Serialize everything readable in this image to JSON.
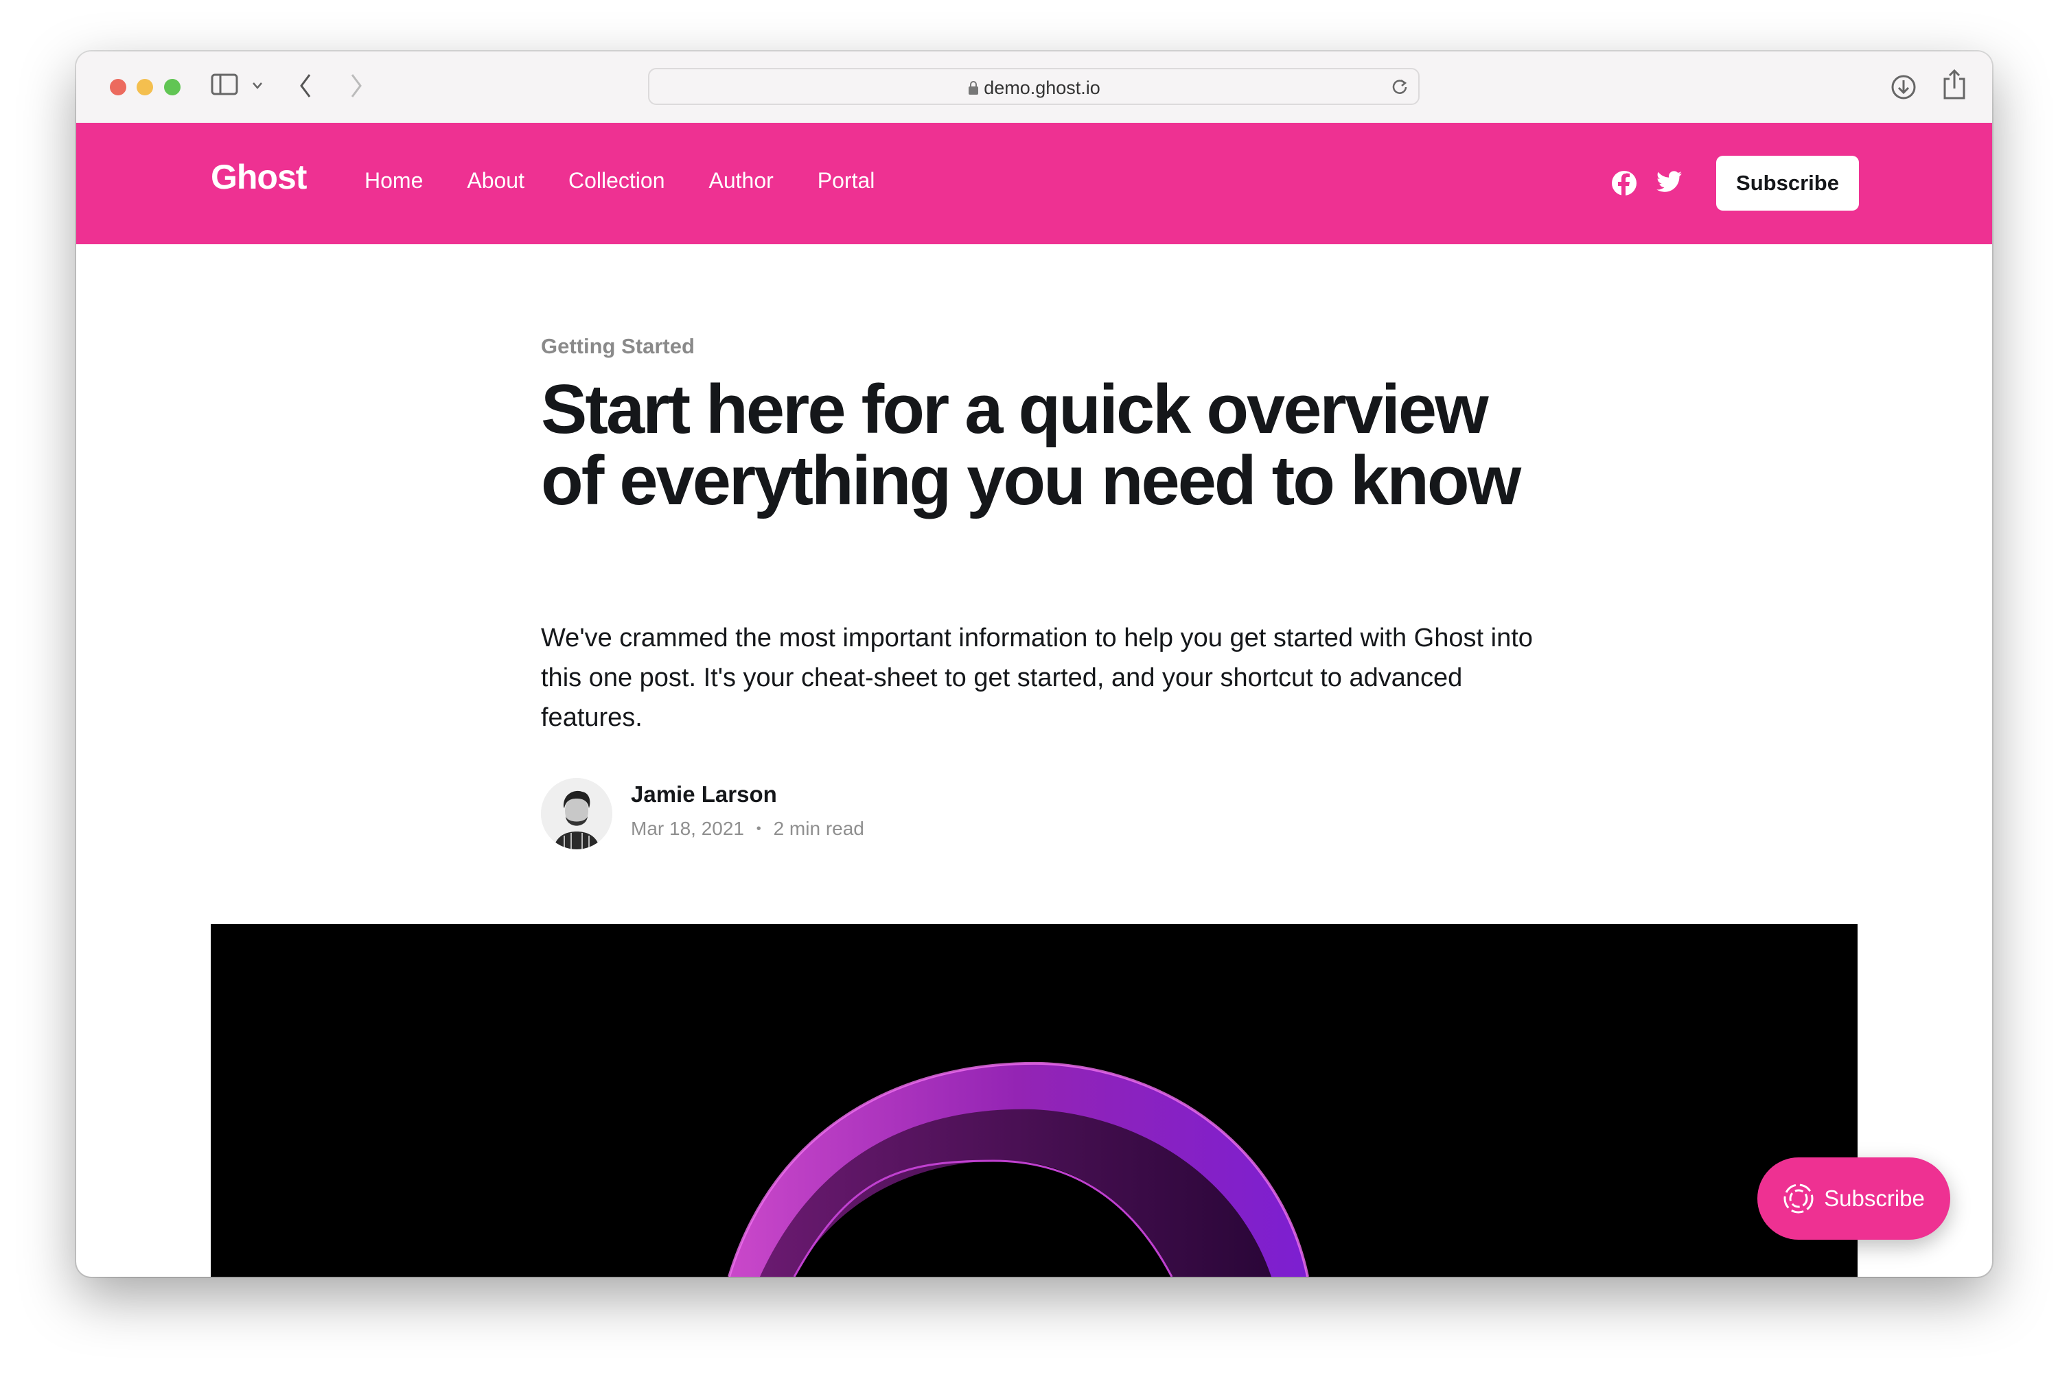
{
  "browser": {
    "url": "demo.ghost.io",
    "icons": [
      "sidebar-icon",
      "chevron-down-icon",
      "back-icon",
      "forward-icon",
      "lock-icon",
      "reload-icon",
      "download-icon",
      "share-icon"
    ]
  },
  "nav": {
    "logo": "Ghost",
    "links": [
      "Home",
      "About",
      "Collection",
      "Author",
      "Portal"
    ],
    "subscribe_label": "Subscribe",
    "accent_color": "#ee3192"
  },
  "post": {
    "category": "Getting Started",
    "title": "Start here for a quick overview of everything you need to know",
    "excerpt": "We've crammed the most important information to help you get started with Ghost into this one post. It's your cheat-sheet to get started, and your shortcut to advanced features.",
    "author": "Jamie Larson",
    "date": "Mar 18, 2021",
    "separator": "•",
    "read_time": "2 min read"
  },
  "portal": {
    "subscribe_label": "Subscribe"
  }
}
